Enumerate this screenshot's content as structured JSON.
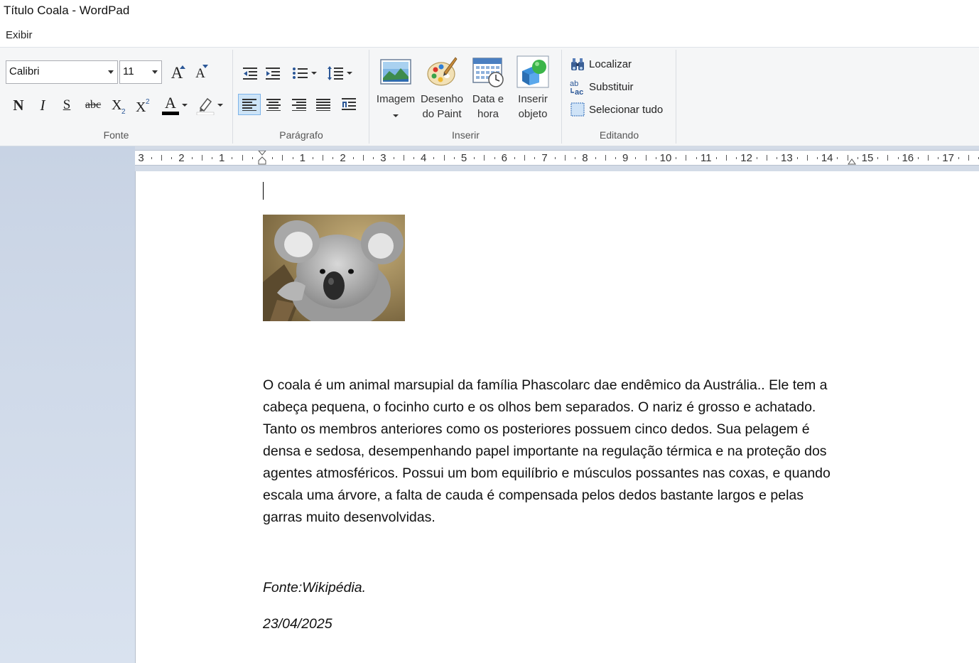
{
  "window": {
    "title": "Título Coala - WordPad"
  },
  "menu": {
    "view": "Exibir"
  },
  "ribbon": {
    "font": {
      "label": "Fonte",
      "family": "Calibri",
      "size": "11",
      "grow_icon": "A",
      "shrink_icon": "A",
      "bold": "N",
      "italic": "I",
      "underline": "S",
      "strike": "abc",
      "text_color_icon": "A"
    },
    "paragraph": {
      "label": "Parágrafo"
    },
    "insert": {
      "label": "Inserir",
      "image": "Imagem",
      "paint_line1": "Desenho",
      "paint_line2": "do Paint",
      "datetime_line1": "Data e",
      "datetime_line2": "hora",
      "object_line1": "Inserir",
      "object_line2": "objeto"
    },
    "editing": {
      "label": "Editando",
      "find": "Localizar",
      "replace": "Substituir",
      "select_all": "Selecionar tudo"
    }
  },
  "ruler": {
    "numbers": [
      "3",
      "2",
      "1",
      "1",
      "2",
      "3",
      "4",
      "5",
      "6",
      "7",
      "8",
      "9",
      "10",
      "11",
      "12",
      "13",
      "14",
      "15",
      "16",
      "17"
    ]
  },
  "document": {
    "lines": [
      "O coala é um animal marsupial da família Phascolarc dae endêmico da Austrália.. Ele tem a",
      "cabeça pequena, o focinho curto e os olhos bem separados. O nariz é grosso e achatado.",
      "Tanto os membros anteriores como os posteriores possuem cinco dedos. Sua pelagem é",
      "densa e sedosa, desempenhando papel importante na regulação térmica e na proteção dos",
      "agentes atmosféricos. Possui um bom equilíbrio e músculos possantes nas coxas, e quando",
      "escala uma árvore, a falta de cauda é compensada pelos dedos bastante largos e pelas",
      "garras muito desenvolvidas."
    ],
    "source": "Fonte:Wikipédia.",
    "date": "23/04/2025"
  }
}
